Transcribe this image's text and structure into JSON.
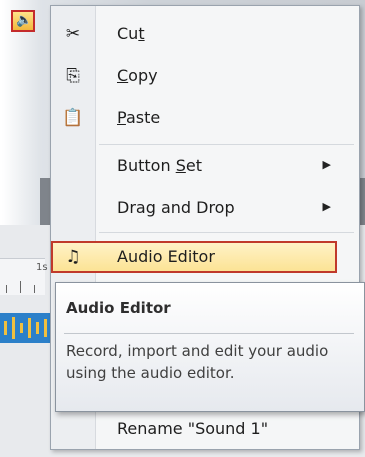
{
  "menu": {
    "items": [
      {
        "pre": "Cu",
        "u": "t",
        "post": "",
        "icon": "scissors-icon",
        "glyph": "✂"
      },
      {
        "pre": "",
        "u": "C",
        "post": "opy",
        "icon": "copy-icon",
        "glyph": "⎘"
      },
      {
        "pre": "",
        "u": "P",
        "post": "aste",
        "icon": "paste-icon",
        "glyph": "📋"
      },
      {
        "pre": "Button ",
        "u": "S",
        "post": "et",
        "submenu": true
      },
      {
        "pre": "Drag and Drop",
        "u": "",
        "post": "",
        "submenu": true
      },
      {
        "pre": "Audio Editor",
        "u": "",
        "post": "",
        "icon": "audio-editor-icon",
        "glyph": "♫",
        "highlighted": true
      },
      {
        "pre": "Rename \"Sound 1\"",
        "u": "",
        "post": ""
      }
    ],
    "submenu_arrow": "▶"
  },
  "tooltip": {
    "title": "Audio Editor",
    "body": "Record, import and edit your audio using the audio editor."
  },
  "background": {
    "ruler_label": "1s"
  },
  "colors": {
    "highlight_border": "#c0392b",
    "highlight_fill": "#fce395",
    "waveform": "#2c80c9"
  }
}
